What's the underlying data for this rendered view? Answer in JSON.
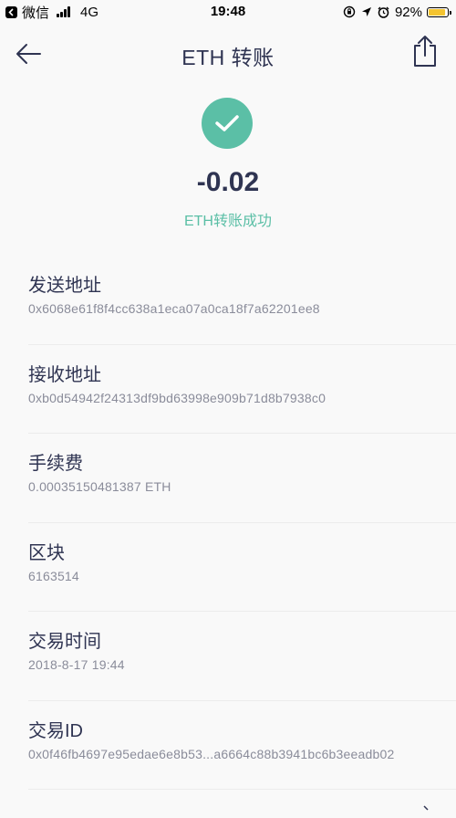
{
  "status_bar": {
    "carrier": "微信",
    "network": "4G",
    "time": "19:48",
    "battery": "92%",
    "battery_level": 0.92,
    "icons": [
      "back-to-app-icon",
      "signal-icon",
      "rotation-lock-icon",
      "location-icon",
      "alarm-icon",
      "battery-icon"
    ]
  },
  "nav": {
    "title": "ETH 转账",
    "back_icon": "back-arrow-icon",
    "share_icon": "share-icon"
  },
  "transaction": {
    "amount": "-0.02",
    "status": "ETH转账成功",
    "status_icon": "checkmark-icon",
    "accent_color": "#5bbfa6"
  },
  "details": [
    {
      "label": "发送地址",
      "value": "0x6068e61f8f4cc638a1eca07a0ca18f7a62201ee8"
    },
    {
      "label": "接收地址",
      "value": "0xb0d54942f24313df9bd63998e909b71d8b7938c0"
    },
    {
      "label": "手续费",
      "value": "0.00035150481387 ETH"
    },
    {
      "label": "区块",
      "value": "6163514"
    },
    {
      "label": "交易时间",
      "value": "2018-8-17 19:44"
    },
    {
      "label": "交易ID",
      "value": "0x0f46fb4697e95edae6e8b53...a6664c88b3941bc6b3eeadb02"
    }
  ]
}
